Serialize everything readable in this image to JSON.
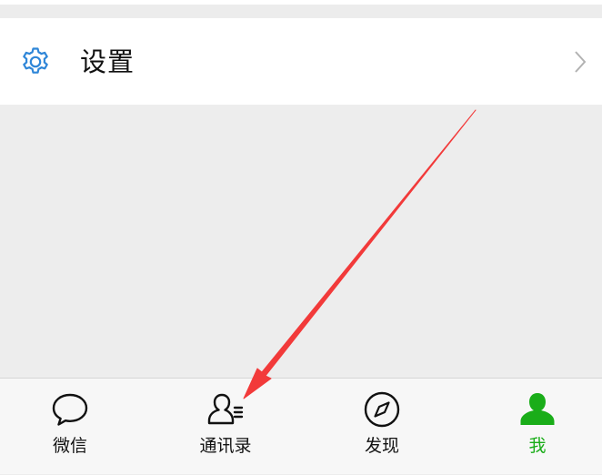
{
  "settings": {
    "label": "设置",
    "icon": "gear-icon",
    "chevron_icon": "chevron-right-icon"
  },
  "tabbar": {
    "tabs": [
      {
        "label": "微信",
        "icon": "chat-bubble-icon",
        "active": false
      },
      {
        "label": "通讯录",
        "icon": "contacts-icon",
        "active": false
      },
      {
        "label": "发现",
        "icon": "compass-icon",
        "active": false
      },
      {
        "label": "我",
        "icon": "person-icon",
        "active": true
      }
    ]
  },
  "colors": {
    "accent": "#1aad19",
    "gear": "#2f86d8",
    "annotation_arrow": "#f23a3a",
    "background": "#ededed",
    "tabbar_bg": "#f7f7f7"
  }
}
